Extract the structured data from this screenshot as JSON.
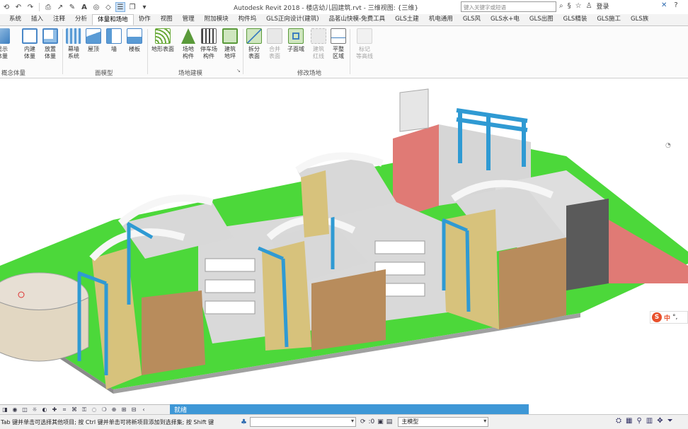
{
  "quick_access": {
    "items": [
      "open-icon",
      "undo-icon",
      "redo-icon",
      "print-icon",
      "measure-icon",
      "tag-icon",
      "text-icon",
      "view-3d-icon",
      "section-icon",
      "thin-lines-icon",
      "switch-windows-icon",
      "customize-icon"
    ]
  },
  "title": {
    "document": "Autodesk Revit 2018 -   楼店幼儿园建筑.rvt - 三维视图: {三维}"
  },
  "search": {
    "placeholder": "键入关键字或短语"
  },
  "account": {
    "login": "登录"
  },
  "tabs": [
    "系统",
    "插入",
    "注释",
    "分析",
    "体量和场地",
    "协作",
    "视图",
    "管理",
    "附加模块",
    "构件坞",
    "GLS正向设计(建筑)",
    "品茗山快模-免费工具",
    "GLS土建",
    "机电通用",
    "GLS风",
    "GLS水+电",
    "GLS出图",
    "GLS精装",
    "GLS施工",
    "GLS族"
  ],
  "active_tab": "体量和场地",
  "ribbon": {
    "conceptual_mass": {
      "label": "概念体量",
      "tools": [
        {
          "label": "显示\n体量",
          "icon": "mass-show-icon"
        },
        {
          "label": "内建\n体量",
          "icon": "in-place-mass-icon"
        },
        {
          "label": "放置\n体量",
          "icon": "place-mass-icon"
        }
      ]
    },
    "model_by_face": {
      "label": "面模型",
      "tools": [
        {
          "label": "幕墙\n系统",
          "icon": "curtain-system-icon"
        },
        {
          "label": "屋顶",
          "icon": "roof-icon"
        },
        {
          "label": "墙",
          "icon": "wall-icon"
        },
        {
          "label": "楼板",
          "icon": "floor-icon"
        }
      ]
    },
    "model_site": {
      "label": "场地建模",
      "tools": [
        {
          "label": "地形表面",
          "icon": "toposurface-icon"
        },
        {
          "label": "场地\n构件",
          "icon": "site-component-icon"
        },
        {
          "label": "停车场\n构件",
          "icon": "parking-icon"
        },
        {
          "label": "建筑\n地坪",
          "icon": "building-pad-icon"
        }
      ]
    },
    "modify_site": {
      "label": "修改场地",
      "tools": [
        {
          "label": "拆分\n表面",
          "icon": "split-surface-icon",
          "enabled": true
        },
        {
          "label": "合并\n表面",
          "icon": "merge-surfaces-icon",
          "enabled": false
        },
        {
          "label": "子面域",
          "icon": "subregion-icon",
          "enabled": true
        },
        {
          "label": "建筑\n红线",
          "icon": "property-line-icon",
          "enabled": false
        },
        {
          "label": "平整\n区域",
          "icon": "graded-region-icon",
          "enabled": true
        },
        {
          "label": "标记\n等高线",
          "icon": "label-contours-icon",
          "enabled": false
        }
      ]
    }
  },
  "viewport": {
    "description_colors": {
      "ground": "#4cd83a",
      "facade_yellow": "#d7c27c",
      "end_wall_brown": "#b88c5c",
      "roof_grey": "#d8d8d8",
      "stair_blue": "#2f9ad3",
      "red_wall": "#e07a75",
      "dark_wall": "#5a5a5a"
    }
  },
  "ime": {
    "label": "中"
  },
  "view_control_bar": {
    "icons": [
      "scale-icon",
      "detail-level-icon",
      "visual-style-icon",
      "sun-path-icon",
      "shadows-icon",
      "render-icon",
      "crop-icon",
      "show-crop-icon",
      "lock-3d-icon",
      "temp-hide-icon",
      "reveal-hidden-icon",
      "analytical-icon",
      "highlight-icon",
      "constraints-icon",
      "expand-icon"
    ]
  },
  "prompt": {
    "text": "就绪"
  },
  "status": {
    "text": "Tab 键并单击可选择其他项目; 按 Ctrl 键并单击可将新项目添加到选择集; 按 Shift 键",
    "model": "主模型"
  }
}
